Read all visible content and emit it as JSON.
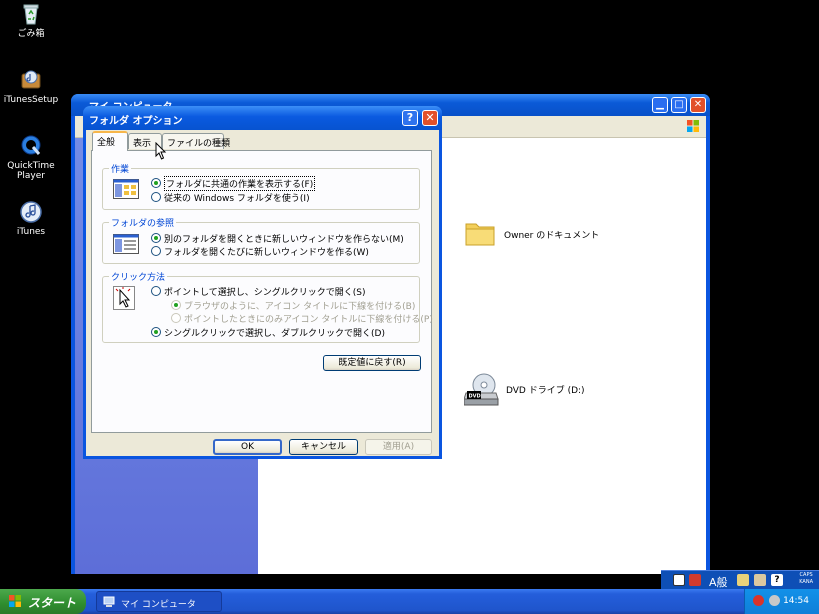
{
  "desktop": {
    "icons": [
      {
        "label": "ごみ箱",
        "icon": "recycle-bin-icon"
      },
      {
        "label": "iTunesSetup",
        "icon": "itunes-setup-icon"
      },
      {
        "label": "QuickTime Player",
        "icon": "quicktime-icon"
      },
      {
        "label": "iTunes",
        "icon": "itunes-icon"
      }
    ]
  },
  "my_computer": {
    "title": "マイ コンピュータ",
    "items": [
      {
        "label": "Owner のドキュメント",
        "icon": "folder-icon"
      },
      {
        "label": "DVD ドライブ (D:)",
        "icon": "dvd-drive-icon"
      }
    ]
  },
  "dialog": {
    "title": "フォルダ オプション",
    "help": "?",
    "close": "✕",
    "tabs": [
      {
        "label": "全般",
        "active": true
      },
      {
        "label": "表示",
        "active": false
      },
      {
        "label": "ファイルの種類",
        "active": false
      }
    ],
    "groups": {
      "tasks": {
        "title": "作業",
        "options": [
          {
            "label": "フォルダに共通の作業を表示する(F)",
            "checked": true
          },
          {
            "label": "従来の Windows フォルダを使う(I)",
            "checked": false
          }
        ]
      },
      "browse": {
        "title": "フォルダの参照",
        "options": [
          {
            "label": "別のフォルダを開くときに新しいウィンドウを作らない(M)",
            "checked": true
          },
          {
            "label": "フォルダを開くたびに新しいウィンドウを作る(W)",
            "checked": false
          }
        ]
      },
      "click": {
        "title": "クリック方法",
        "options": [
          {
            "label": "ポイントして選択し、シングルクリックで開く(S)",
            "checked": false
          },
          {
            "label": "ブラウザのように、アイコン タイトルに下線を付ける(B)",
            "checked": true,
            "disabled": true
          },
          {
            "label": "ポイントしたときにのみアイコン タイトルに下線を付ける(P)",
            "checked": false,
            "disabled": true
          },
          {
            "label": "シングルクリックで選択し、ダブルクリックで開く(D)",
            "checked": true
          }
        ]
      }
    },
    "restore_defaults": "既定値に戻す(R)",
    "ok": "OK",
    "cancel": "キャンセル",
    "apply": "適用(A)"
  },
  "taskbar": {
    "start": "スタート",
    "task_item": "マイ コンピュータ",
    "clock": "14:54",
    "language": "A般",
    "caps": "CAPS",
    "kana": "KANA"
  },
  "colors": {
    "desktop_bg": "#000000",
    "xp_blue": "#0a55e0",
    "group_title": "#0046d5",
    "start_green": "#2e8d2e"
  }
}
